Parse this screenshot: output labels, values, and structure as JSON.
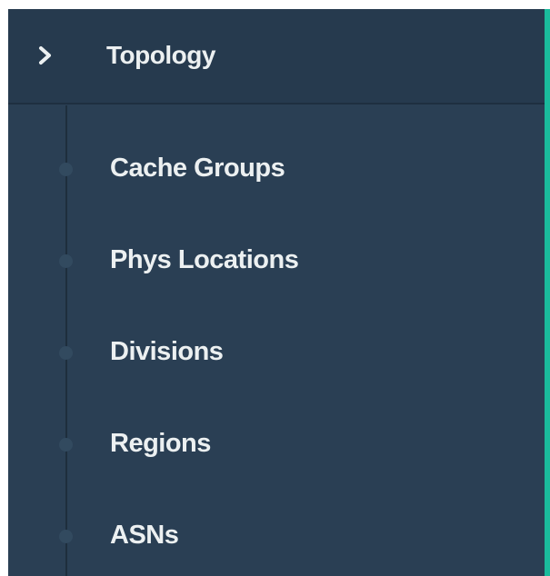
{
  "sidebar": {
    "section": {
      "label": "Topology",
      "icon": "chevron-right-icon"
    },
    "items": [
      {
        "label": "Cache Groups"
      },
      {
        "label": "Phys Locations"
      },
      {
        "label": "Divisions"
      },
      {
        "label": "Regions"
      },
      {
        "label": "ASNs"
      }
    ]
  },
  "colors": {
    "background": "#2a3f54",
    "header_background": "#263a4e",
    "text": "#ecf0f1",
    "accent": "#1abb9c",
    "bullet": "#324a5f"
  }
}
